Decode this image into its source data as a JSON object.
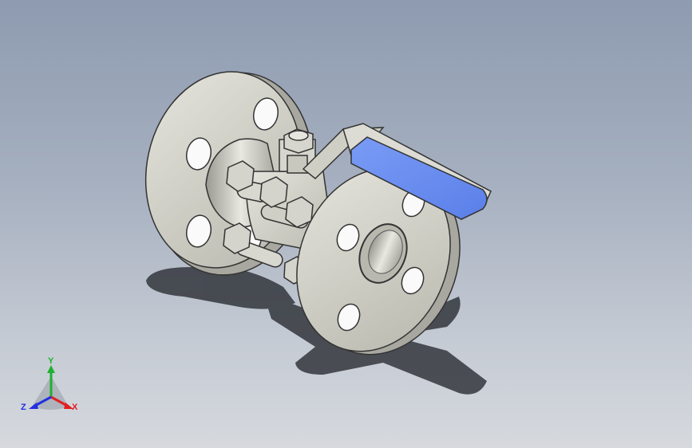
{
  "viewport": {
    "background_top": "#8e9bb0",
    "background_bottom": "#d6d9de"
  },
  "model": {
    "icon": "flanged-ball-valve-3d-model",
    "body_color": "#cfcfc6",
    "handle_grip_color": "#6b8ff0"
  },
  "triad": {
    "x_label": "X",
    "y_label": "Y",
    "z_label": "Z",
    "x_color": "#e02020",
    "y_color": "#20b030",
    "z_color": "#2030e0"
  }
}
